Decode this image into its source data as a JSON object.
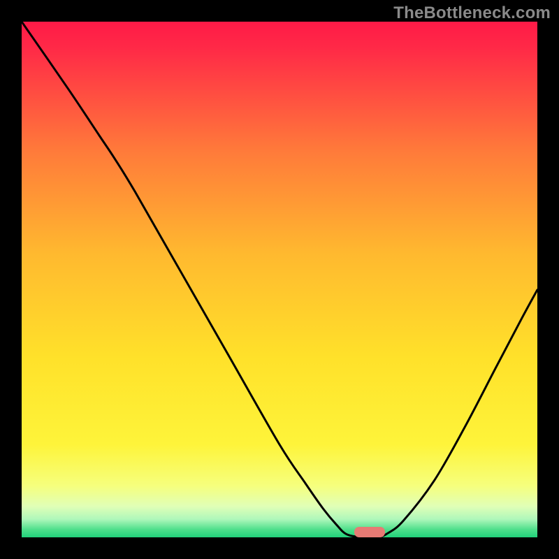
{
  "watermark": "TheBottleneck.com",
  "chart_data": {
    "type": "line",
    "title": "",
    "xlabel": "",
    "ylabel": "",
    "xlim": [
      0,
      100
    ],
    "ylim": [
      0,
      100
    ],
    "gradient_stops": [
      {
        "offset": 0.0,
        "color": "#ff1a47"
      },
      {
        "offset": 0.05,
        "color": "#ff2947"
      },
      {
        "offset": 0.25,
        "color": "#ff7a3a"
      },
      {
        "offset": 0.45,
        "color": "#ffb92f"
      },
      {
        "offset": 0.65,
        "color": "#ffe12a"
      },
      {
        "offset": 0.82,
        "color": "#fef43a"
      },
      {
        "offset": 0.9,
        "color": "#f6ff7d"
      },
      {
        "offset": 0.94,
        "color": "#e0ffb7"
      },
      {
        "offset": 0.965,
        "color": "#aef7ba"
      },
      {
        "offset": 0.985,
        "color": "#4edf8b"
      },
      {
        "offset": 1.0,
        "color": "#21d17b"
      }
    ],
    "series": [
      {
        "name": "bottleneck-curve",
        "color": "#000000",
        "stroke_width": 3,
        "points": [
          {
            "x": 0.0,
            "y": 100.0
          },
          {
            "x": 9.0,
            "y": 87.0
          },
          {
            "x": 15.0,
            "y": 78.0
          },
          {
            "x": 18.0,
            "y": 73.5
          },
          {
            "x": 22.0,
            "y": 67.0
          },
          {
            "x": 30.0,
            "y": 53.0
          },
          {
            "x": 40.0,
            "y": 35.5
          },
          {
            "x": 50.0,
            "y": 18.0
          },
          {
            "x": 55.0,
            "y": 10.5
          },
          {
            "x": 58.5,
            "y": 5.5
          },
          {
            "x": 61.0,
            "y": 2.5
          },
          {
            "x": 63.0,
            "y": 0.6
          },
          {
            "x": 66.0,
            "y": 0.0
          },
          {
            "x": 69.0,
            "y": 0.0
          },
          {
            "x": 71.0,
            "y": 0.8
          },
          {
            "x": 74.0,
            "y": 3.2
          },
          {
            "x": 80.0,
            "y": 11.0
          },
          {
            "x": 86.0,
            "y": 21.5
          },
          {
            "x": 92.0,
            "y": 33.0
          },
          {
            "x": 97.0,
            "y": 42.5
          },
          {
            "x": 100.0,
            "y": 48.0
          }
        ]
      }
    ],
    "marker": {
      "name": "optimum-marker",
      "color": "#e77a74",
      "x": 67.5,
      "y": 0.0,
      "width_pct": 6.0,
      "height_pct": 2.0
    }
  }
}
